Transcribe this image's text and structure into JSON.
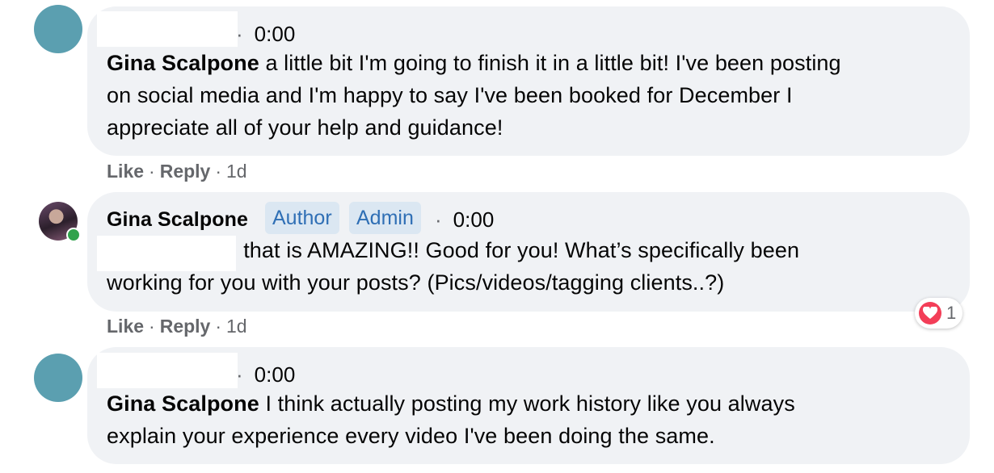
{
  "comments": [
    {
      "timestamp": "0:00",
      "lines": [
        {
          "name": "Gina Scalpone",
          "text": " a little bit I'm going to finish it in a little bit! I've been posting"
        },
        {
          "text": "on social media and I'm happy to say I've been booked for December I"
        },
        {
          "text": "appreciate all of your help and guidance!"
        }
      ],
      "actions": {
        "like": "Like",
        "reply": "Reply",
        "age": "1d"
      }
    },
    {
      "author": "Gina Scalpone",
      "badges": [
        "Author",
        "Admin"
      ],
      "timestamp": "0:00",
      "lines": [
        {
          "text": "ı that is AMAZING!! Good for you! What’s specifically been"
        },
        {
          "text": "working for you with your posts? (Pics/videos/tagging clients..?)"
        }
      ],
      "reaction": {
        "icon": "heart-icon",
        "count": "1",
        "color": "#f33e58"
      },
      "actions": {
        "like": "Like",
        "reply": "Reply",
        "age": "1d"
      }
    },
    {
      "timestamp": "0:00",
      "lines": [
        {
          "name": "Gina Scalpone",
          "text": " I think actually posting my work history like you always"
        },
        {
          "text": "explain your experience every video I've been doing the same."
        }
      ]
    }
  ],
  "separator": "·",
  "colors": {
    "bubble": "#f0f2f5",
    "badge_bg": "#dbe7f2",
    "badge_text": "#2f6fb5",
    "avatar": "#5b9fb0"
  }
}
